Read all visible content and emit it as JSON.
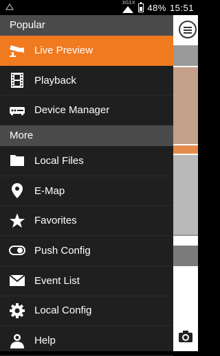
{
  "status_bar": {
    "network_label": "3G1X",
    "battery": "48%",
    "time": "15:51",
    "battery_level": 0.48
  },
  "drawer": {
    "sections": [
      {
        "title": "Popular",
        "items": [
          {
            "label": "Live Preview",
            "icon": "camera-icon",
            "active": true
          },
          {
            "label": "Playback",
            "icon": "film-icon"
          },
          {
            "label": "Device Manager",
            "icon": "device-icon"
          }
        ]
      },
      {
        "title": "More",
        "items": [
          {
            "label": "Local Files",
            "icon": "folder-icon"
          },
          {
            "label": "E-Map",
            "icon": "map-pin-icon"
          },
          {
            "label": "Favorites",
            "icon": "star-icon"
          },
          {
            "label": "Push Config",
            "icon": "toggle-icon"
          },
          {
            "label": "Event List",
            "icon": "envelope-icon"
          },
          {
            "label": "Local Config",
            "icon": "gear-icon"
          },
          {
            "label": "Help",
            "icon": "person-icon"
          }
        ]
      }
    ]
  },
  "colors": {
    "accent": "#f07a20",
    "drawer_bg": "#1f1f1f",
    "section_bg": "#4b4b4b"
  }
}
